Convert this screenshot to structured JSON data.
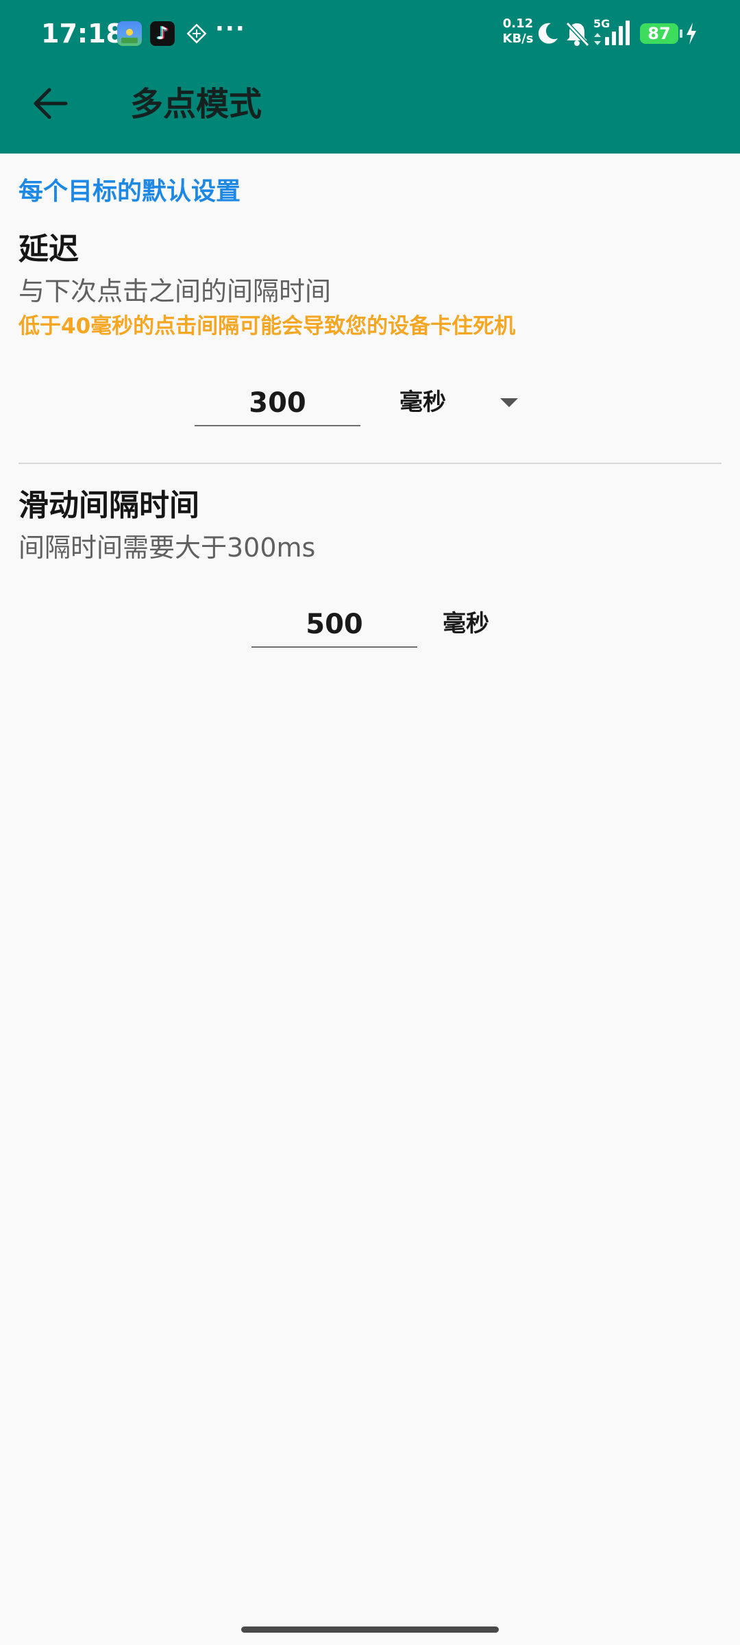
{
  "status_bar": {
    "time": "17:18",
    "app_icons": [
      "game-icon",
      "tiktok-icon",
      "diamond-icon"
    ],
    "more": "···",
    "net_speed_value": "0.12",
    "net_speed_unit": "KB/s",
    "signal_label": "5G",
    "battery_level": "87"
  },
  "app_bar": {
    "title": "多点模式",
    "back_icon": "back-arrow-icon",
    "background_color": "#008577"
  },
  "section": {
    "header": "每个目标的默认设置",
    "header_color": "#1e88e5"
  },
  "delay": {
    "title": "延迟",
    "summary": "与下次点击之间的间隔时间",
    "warning": "低于40毫秒的点击间隔可能会导致您的设备卡住死机",
    "warning_color": "#f5a623",
    "value": "300",
    "unit": "毫秒"
  },
  "swipe_interval": {
    "title": "滑动间隔时间",
    "summary": "间隔时间需要大于300ms",
    "value": "500",
    "unit": "毫秒"
  }
}
